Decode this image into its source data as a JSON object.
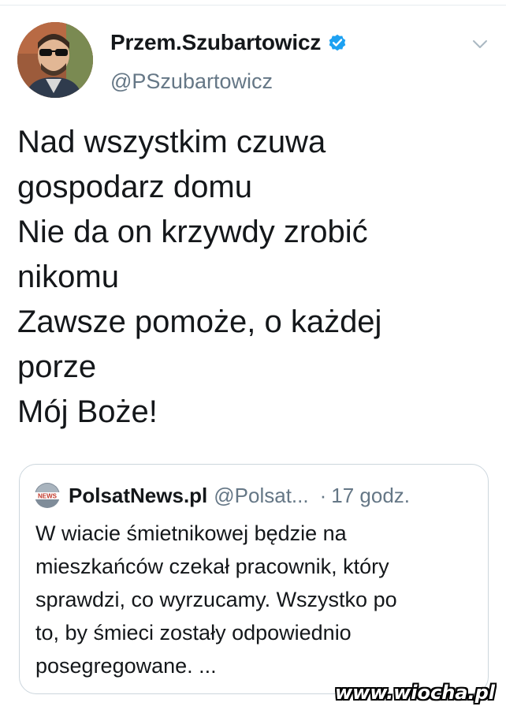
{
  "author": {
    "display_name": "Przem.Szubartowicz",
    "handle": "@PSzubartowicz",
    "verified": true,
    "avatar_icon": "profile-photo"
  },
  "menu": {
    "icon": "chevron-down-icon"
  },
  "tweet": {
    "lines": [
      "Nad wszystkim czuwa",
      "gospodarz domu",
      "Nie da on krzywdy zrobić",
      "nikomu",
      "Zawsze pomoże, o każdej",
      "porze",
      "Mój Boże!"
    ]
  },
  "quoted": {
    "logo_text": "NEWS",
    "name": "PolsatNews.pl",
    "handle": "@Polsat...",
    "separator": "·",
    "time": "17 godz.",
    "lines": [
      "W wiacie śmietnikowej będzie na",
      "mieszkańców czekał pracownik, który",
      "sprawdzi, co wyrzucamy. Wszystko po",
      "to, by śmieci zostały odpowiednio",
      "posegregowane. ..."
    ]
  },
  "watermark": "www.wiocha.pl",
  "colors": {
    "text": "#14171a",
    "secondary": "#657786",
    "verified_blue": "#1da1f2",
    "border": "#ccd6dd"
  }
}
